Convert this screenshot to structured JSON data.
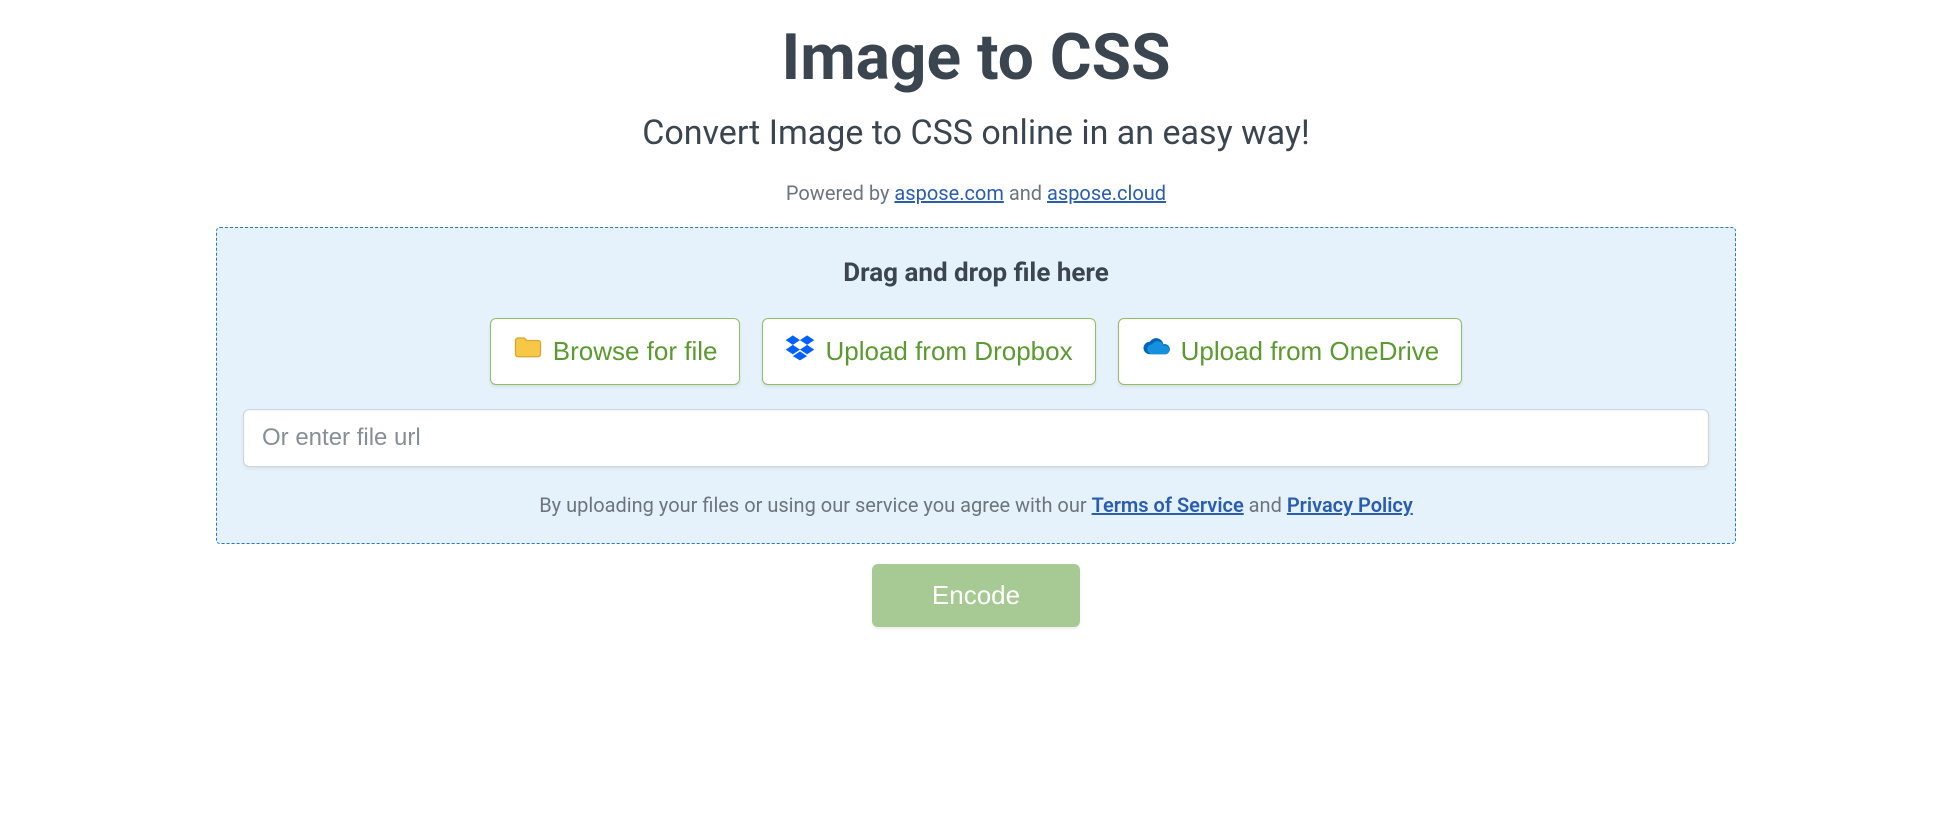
{
  "header": {
    "title": "Image to CSS",
    "subtitle": "Convert Image to CSS online in an easy way!",
    "powered_prefix": "Powered by ",
    "powered_link1": "aspose.com",
    "powered_mid": " and ",
    "powered_link2": "aspose.cloud"
  },
  "dropzone": {
    "drop_text": "Drag and drop file here",
    "browse_label": "Browse for file",
    "dropbox_label": "Upload from Dropbox",
    "onedrive_label": "Upload from OneDrive",
    "url_placeholder": "Or enter file url",
    "agree_prefix": "By uploading your files or using our service you agree with our ",
    "terms_label": "Terms of Service",
    "agree_mid": " and ",
    "privacy_label": "Privacy Policy"
  },
  "actions": {
    "encode_label": "Encode"
  }
}
